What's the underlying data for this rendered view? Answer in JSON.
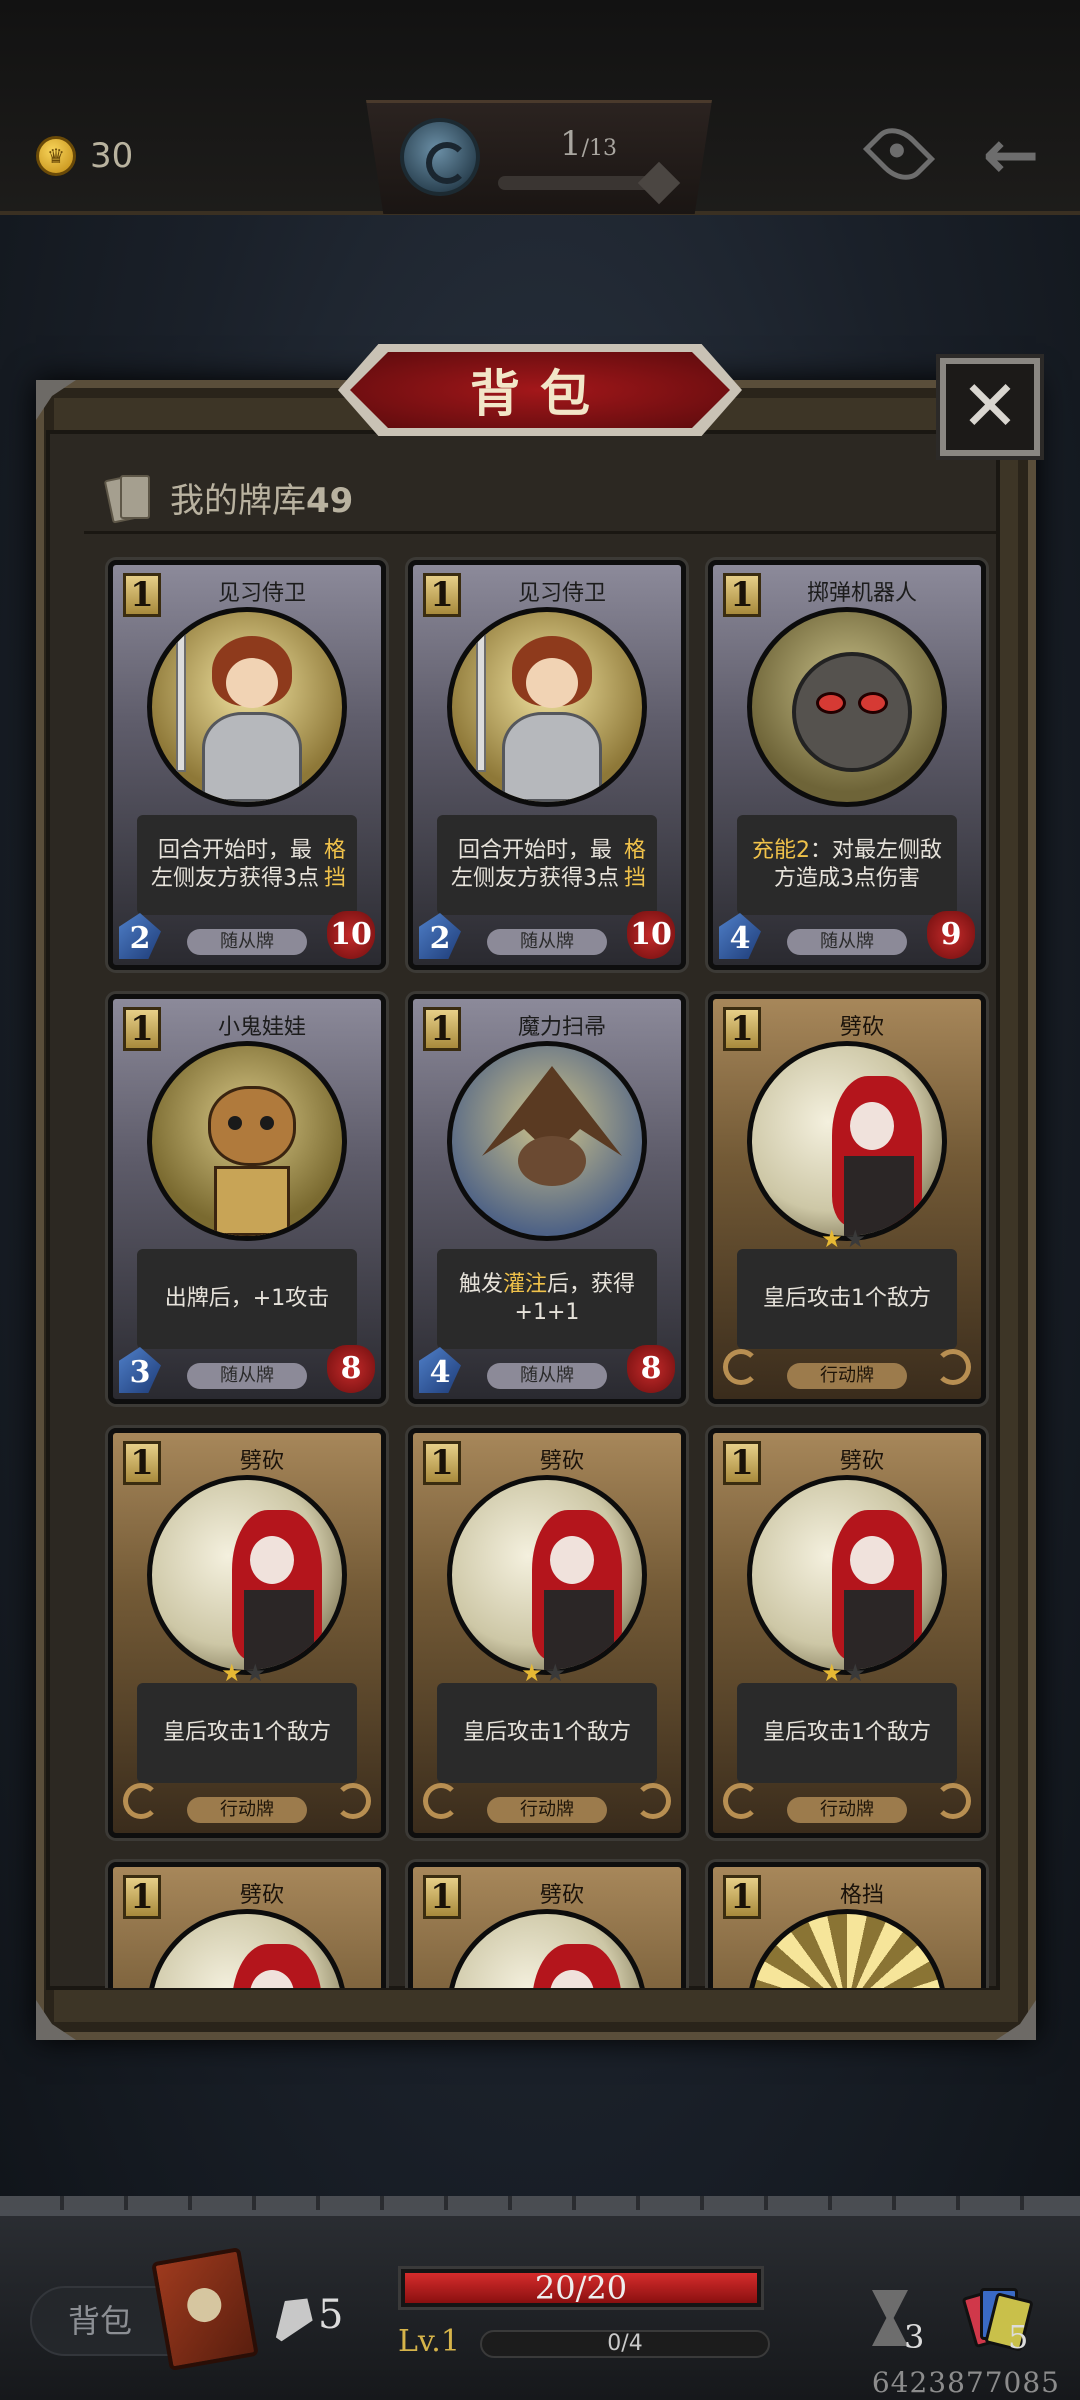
{
  "topbar": {
    "coins": "30",
    "stage_current": "1",
    "stage_total": "/13",
    "icons": [
      "coin-icon",
      "portal-orb-icon",
      "eye-icon",
      "back-arrow-icon"
    ]
  },
  "panel": {
    "title": "背包",
    "close_label": "✕",
    "deck_label": "我的牌库",
    "deck_count": "49"
  },
  "cards": [
    {
      "name": "见习侍卫",
      "cost": "1",
      "kind": "minion",
      "desc": "回合开始时，最左侧友方获得3点格挡",
      "type_label": "随从牌",
      "attack": "2",
      "health": "10"
    },
    {
      "name": "见习侍卫",
      "cost": "1",
      "kind": "minion",
      "desc": "回合开始时，最左侧友方获得3点格挡",
      "type_label": "随从牌",
      "attack": "2",
      "health": "10"
    },
    {
      "name": "掷弹机器人",
      "cost": "1",
      "kind": "minion",
      "desc": "充能2：对最左侧敌方造成3点伤害",
      "type_label": "随从牌",
      "attack": "4",
      "health": "9"
    },
    {
      "name": "小鬼娃娃",
      "cost": "1",
      "kind": "minion",
      "desc": "出牌后，+1攻击",
      "type_label": "随从牌",
      "attack": "3",
      "health": "8"
    },
    {
      "name": "魔力扫帚",
      "cost": "1",
      "kind": "minion",
      "desc": "触发灌注后，获得+1+1",
      "type_label": "随从牌",
      "attack": "4",
      "health": "8"
    },
    {
      "name": "劈砍",
      "cost": "1",
      "kind": "action",
      "desc": "皇后攻击1个敌方",
      "type_label": "行动牌",
      "stars": "1"
    },
    {
      "name": "劈砍",
      "cost": "1",
      "kind": "action",
      "desc": "皇后攻击1个敌方",
      "type_label": "行动牌",
      "stars": "1"
    },
    {
      "name": "劈砍",
      "cost": "1",
      "kind": "action",
      "desc": "皇后攻击1个敌方",
      "type_label": "行动牌",
      "stars": "1"
    },
    {
      "name": "劈砍",
      "cost": "1",
      "kind": "action",
      "desc": "皇后攻击1个敌方",
      "type_label": "行动牌",
      "stars": "1"
    },
    {
      "name": "劈砍",
      "cost": "1",
      "kind": "action"
    },
    {
      "name": "劈砍",
      "cost": "1",
      "kind": "action"
    },
    {
      "name": "格挡",
      "cost": "1",
      "kind": "action"
    }
  ],
  "keywords": {
    "block": "格挡",
    "charge": "充能2",
    "infuse": "灌注"
  },
  "bottombar": {
    "bag_label": "背包",
    "pickaxe_count": "5",
    "hp_text": "20/20",
    "hp_fraction": 1.0,
    "level": "Lv.1",
    "xp_text": "0/4",
    "hourglass_count": "3",
    "deck_count": "5",
    "user_id": "6423877085"
  }
}
